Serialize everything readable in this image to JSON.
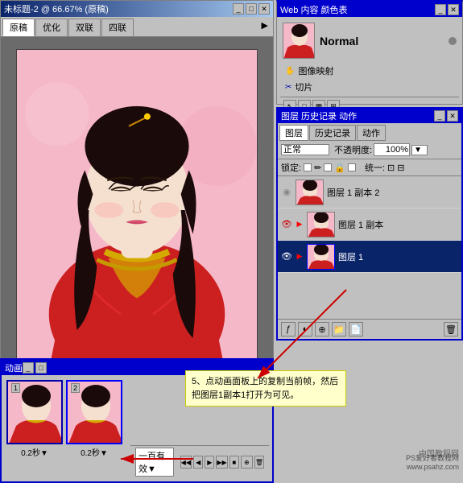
{
  "window": {
    "title": "未标题-2 @ 66.67% (原稿)",
    "tabs": [
      "原稿",
      "优化",
      "双联",
      "四联"
    ]
  },
  "webcontent": {
    "panel_title": "Web 内容  颜色表",
    "tabs": [
      "Web 内容",
      "颜色表"
    ],
    "normal_label": "Normal",
    "menu_items": [
      "图像映射",
      "切片"
    ]
  },
  "layers": {
    "panel_title": "图层  历史记录  动作",
    "tabs": [
      "图层",
      "历史记录",
      "动作"
    ],
    "blend_mode": "正常",
    "opacity_label": "不透明度:",
    "opacity_value": "100%",
    "lock_label": "锁定:",
    "unify_label": "统一:",
    "items": [
      {
        "name": "图层 1 副本 2",
        "visible": false,
        "selected": false
      },
      {
        "name": "图层 1 副本",
        "visible": true,
        "selected": false
      },
      {
        "name": "图层 1",
        "visible": true,
        "selected": true
      }
    ]
  },
  "animation": {
    "panel_title": "动画",
    "frames": [
      {
        "number": "1",
        "duration": "0.2秒▼"
      },
      {
        "number": "2",
        "duration": "0.2秒▼"
      }
    ],
    "loop_label": "一百有效▼"
  },
  "annotation": {
    "text": "5、点动画面板上的复制当前帧，然后把图层1副本1打开为可见。"
  },
  "watermark": {
    "line1": "中国教程网",
    "line2": "PS爱好者教程网",
    "line3": "www.psahz.com"
  }
}
